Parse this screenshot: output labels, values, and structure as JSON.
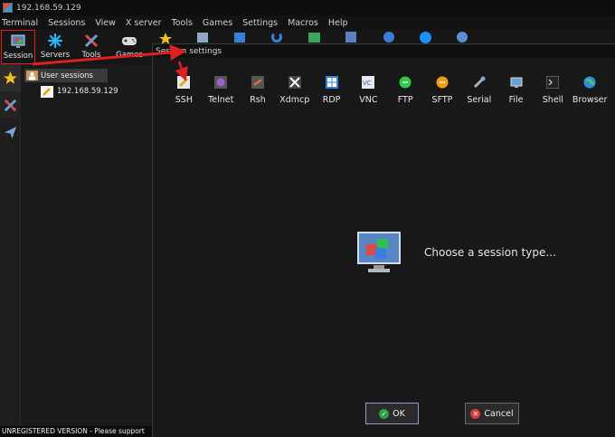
{
  "window": {
    "title": "192.168.59.129"
  },
  "menu": [
    "Terminal",
    "Sessions",
    "View",
    "X server",
    "Tools",
    "Games",
    "Settings",
    "Macros",
    "Help"
  ],
  "toolbar": [
    {
      "label": "Session",
      "icon": "session-icon"
    },
    {
      "label": "Servers",
      "icon": "servers-icon"
    },
    {
      "label": "Tools",
      "icon": "tools-icon"
    },
    {
      "label": "Games",
      "icon": "games-icon"
    }
  ],
  "sessions": {
    "group": "User sessions",
    "items": [
      "192.168.59.129"
    ]
  },
  "dialog": {
    "title": "Session settings",
    "types": [
      "SSH",
      "Telnet",
      "Rsh",
      "Xdmcp",
      "RDP",
      "VNC",
      "FTP",
      "SFTP",
      "Serial",
      "File",
      "Shell",
      "Browser"
    ],
    "prompt": "Choose a session type...",
    "ok": "OK",
    "cancel": "Cancel"
  },
  "status": "UNREGISTERED VERSION  -  Please support",
  "colors": {
    "highlight": "#e02020",
    "accent_blue": "#1e90ff"
  }
}
